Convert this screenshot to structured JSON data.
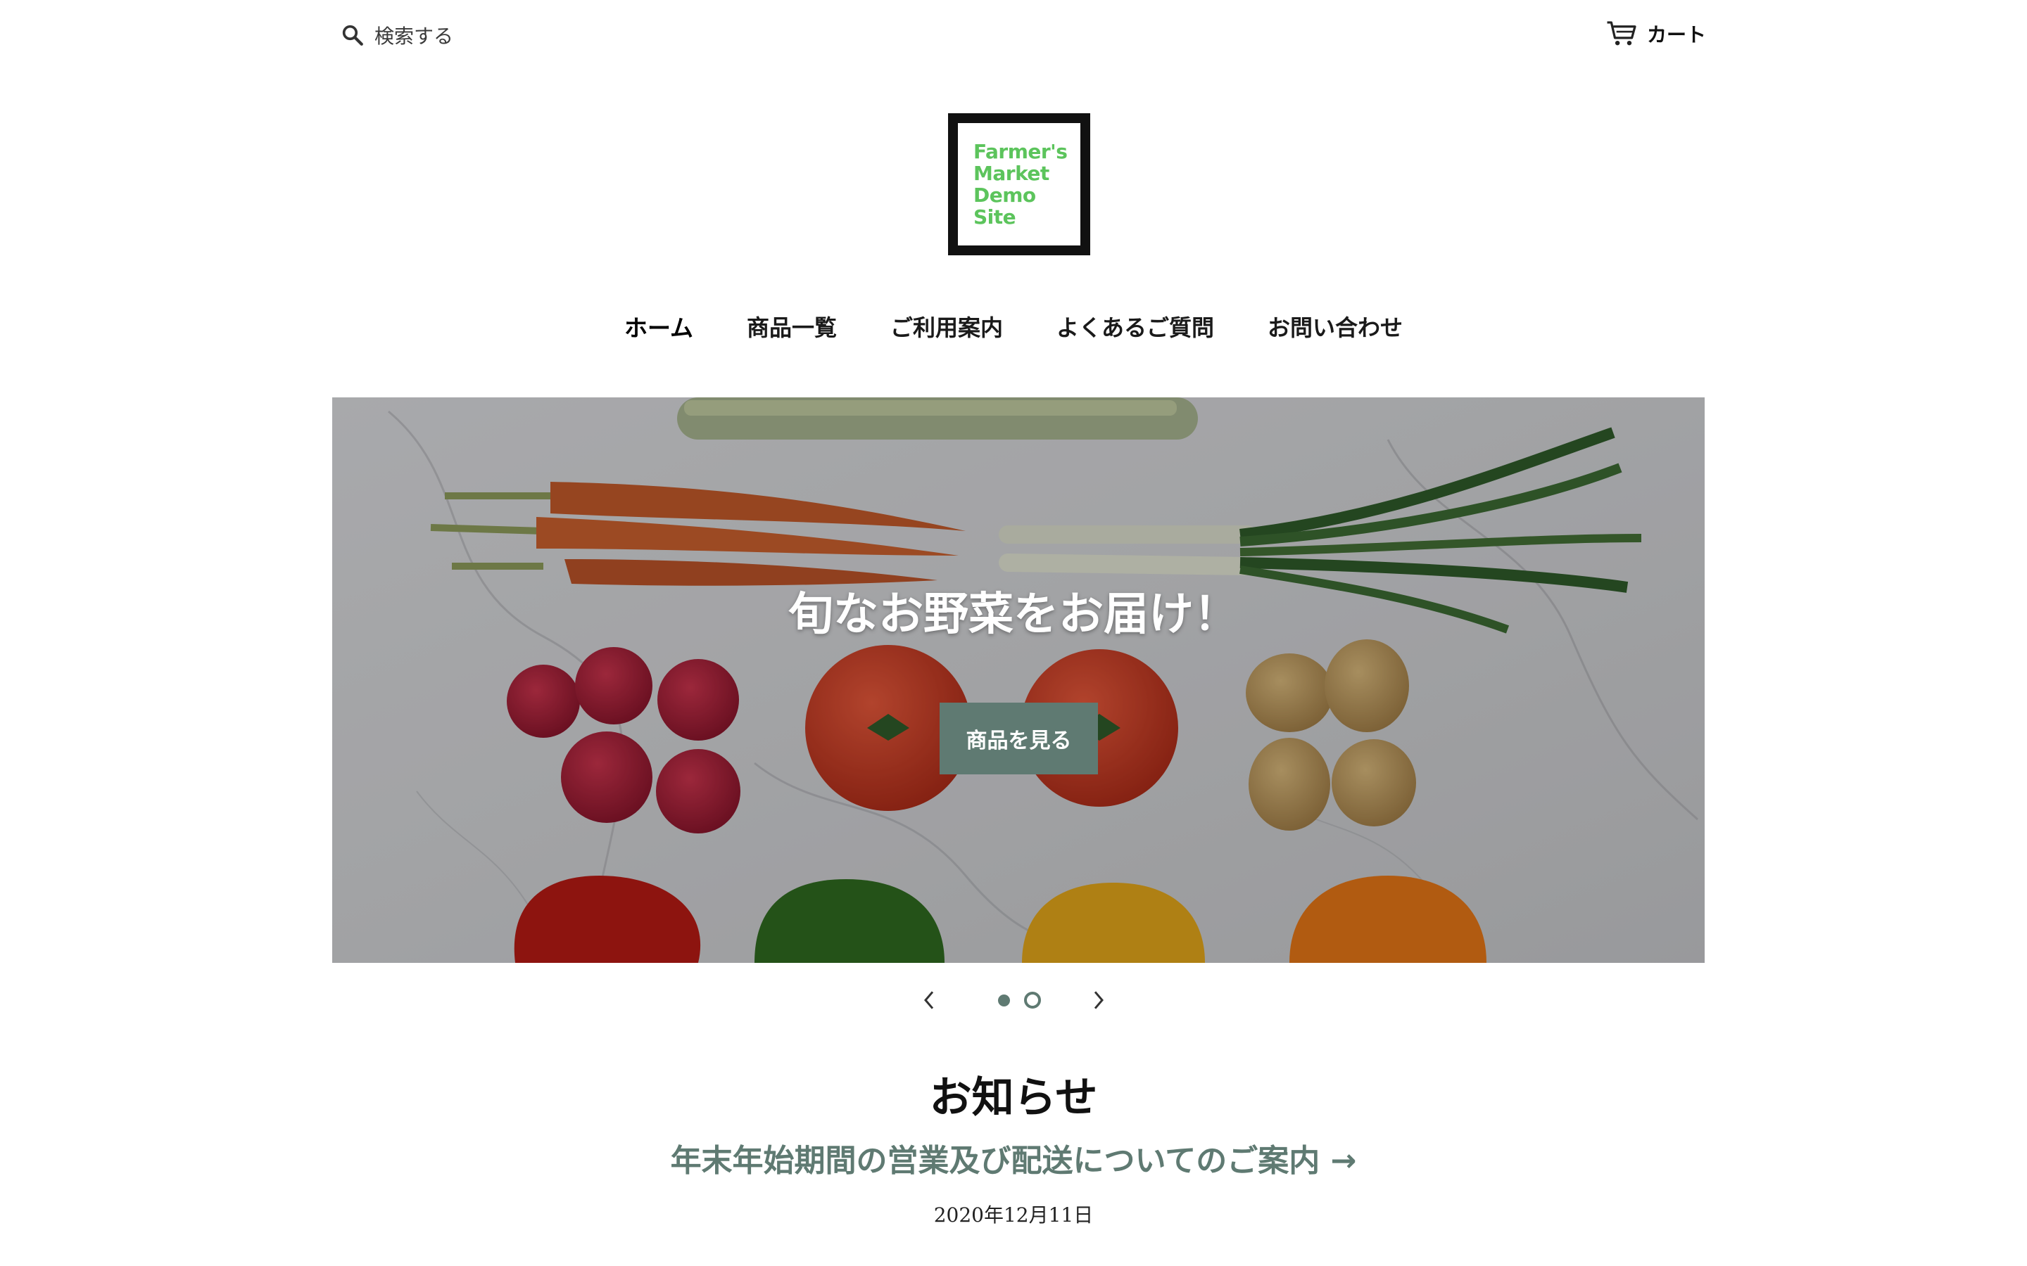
{
  "header": {
    "search_label": "検索する",
    "cart_label": "カート"
  },
  "logo": {
    "lines": [
      "Farmer's",
      "Market",
      "Demo",
      "Site"
    ],
    "text_color": "#5cc45c",
    "border_color": "#111111"
  },
  "nav": {
    "items": [
      {
        "label": "ホーム",
        "active": true
      },
      {
        "label": "商品一覧",
        "active": false
      },
      {
        "label": "ご利用案内",
        "active": false
      },
      {
        "label": "よくあるご質問",
        "active": false
      },
      {
        "label": "お問い合わせ",
        "active": false
      }
    ]
  },
  "hero": {
    "title": "旬なお野菜をお届け！",
    "button_label": "商品を見る",
    "button_color": "#5f7a72",
    "image_subject": "vegetables-on-marble"
  },
  "slider": {
    "prev_icon": "chevron-left-icon",
    "next_icon": "chevron-right-icon",
    "slide_count": 2,
    "active_slide": 1
  },
  "news": {
    "heading": "お知らせ",
    "article_title": "年末年始期間の営業及び配送についてのご案内 →",
    "article_date": "2020年12月11日",
    "link_color": "#5f7a72"
  }
}
